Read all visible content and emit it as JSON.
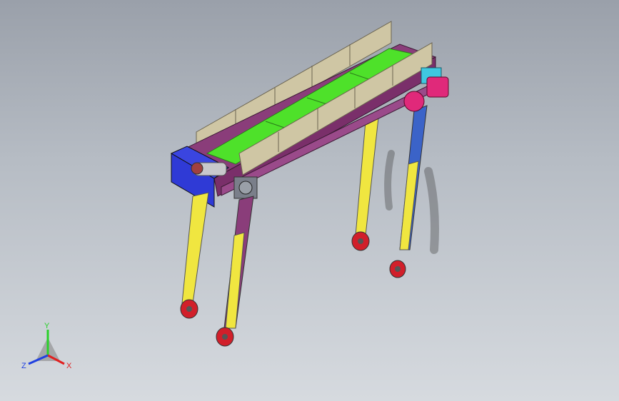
{
  "viewport": {
    "background_top": "#9aa0aa",
    "background_bottom": "#d6dadf"
  },
  "model": {
    "frame_color": "#8a3d7a",
    "belt_color": "#4ee12a",
    "side_guard_color": "#cfc6a4",
    "leg_color": "#f0e640",
    "blue_leg_color": "#3b63c8",
    "end_cap_color": "#2f3ad6",
    "motor_color": "#e0297a",
    "gearbox_color": "#3fc8e0",
    "wheel_color": "#d11f2a"
  },
  "triad": {
    "y_label": "Y",
    "x_label": "X",
    "z_label": "Z",
    "y_color": "#2ad12a",
    "x_color": "#e02020",
    "z_color": "#2040e0"
  }
}
